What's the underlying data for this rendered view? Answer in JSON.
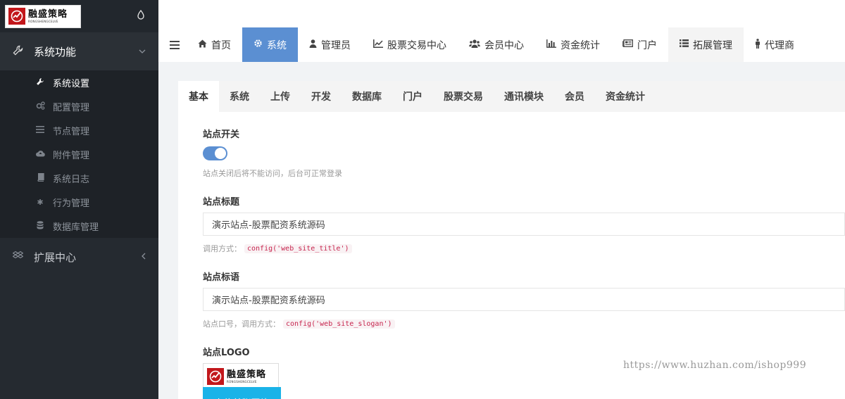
{
  "logo": {
    "cn": "融盛策略",
    "en": "RONGSHENGCELVE"
  },
  "sidebar": {
    "group1": {
      "label": "系统功能",
      "icon": "wrench-icon"
    },
    "items": [
      {
        "label": "系统设置",
        "icon": "wrench-icon"
      },
      {
        "label": "配置管理",
        "icon": "gears-icon"
      },
      {
        "label": "节点管理",
        "icon": "list-icon"
      },
      {
        "label": "附件管理",
        "icon": "cloud-upload-icon"
      },
      {
        "label": "系统日志",
        "icon": "book-icon"
      },
      {
        "label": "行为管理",
        "icon": "asterisk-icon"
      },
      {
        "label": "数据库管理",
        "icon": "database-icon"
      }
    ],
    "group2": {
      "label": "扩展中心",
      "icon": "dropbox-icon"
    }
  },
  "topnav": {
    "tabs": [
      {
        "label": "首页",
        "icon": "home-icon"
      },
      {
        "label": "系统",
        "icon": "gear-icon"
      },
      {
        "label": "管理员",
        "icon": "user-icon"
      },
      {
        "label": "股票交易中心",
        "icon": "line-chart-icon"
      },
      {
        "label": "会员中心",
        "icon": "users-icon"
      },
      {
        "label": "资金统计",
        "icon": "bar-chart-icon"
      },
      {
        "label": "门户",
        "icon": "newspaper-icon"
      },
      {
        "label": "拓展管理",
        "icon": "list-icon"
      },
      {
        "label": "代理商",
        "icon": "male-icon"
      }
    ]
  },
  "subtabs": [
    "基本",
    "系统",
    "上传",
    "开发",
    "数据库",
    "门户",
    "股票交易",
    "通讯模块",
    "会员",
    "资金统计"
  ],
  "form": {
    "site_switch": {
      "label": "站点开关",
      "help": "站点关闭后将不能访问，后台可正常登录"
    },
    "site_title": {
      "label": "站点标题",
      "value": "演示站点-股票配资系统源码",
      "help": "调用方式：",
      "code": "config('web_site_title')"
    },
    "site_slogan": {
      "label": "站点标语",
      "value": "演示站点-股票配资系统源码",
      "help": "站点口号，调用方式：",
      "code": "config('web_site_slogan')"
    },
    "site_logo": {
      "label": "站点LOGO"
    },
    "upload_label": "上传单张图片"
  },
  "watermark": "https://www.huzhan.com/ishop999",
  "colors": {
    "accent": "#5b8fd2",
    "sidebar": "#252a30",
    "upload": "#1ab3e8",
    "brand": "#c2171b"
  }
}
